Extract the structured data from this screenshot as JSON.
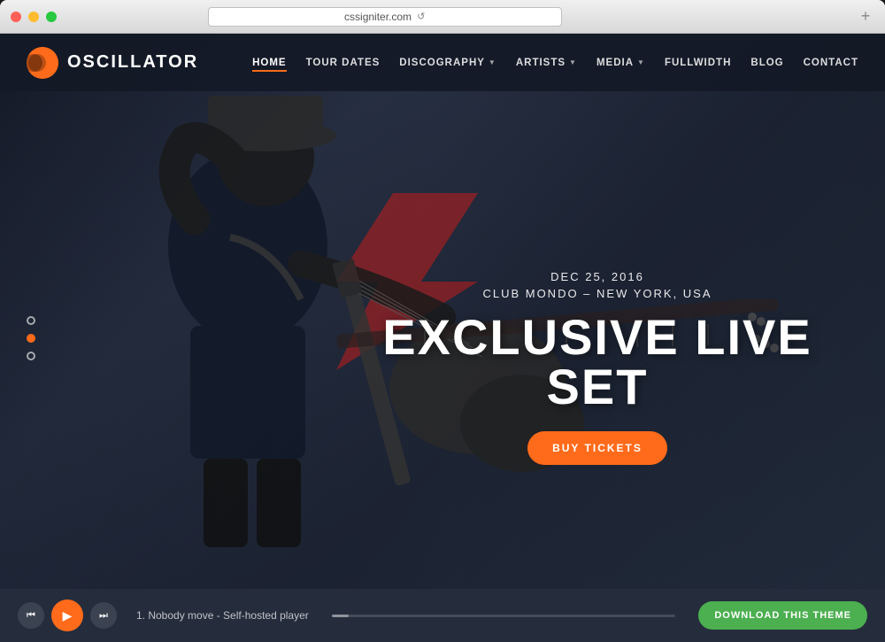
{
  "browser": {
    "url": "cssigniter.com",
    "new_tab_label": "+"
  },
  "logo": {
    "icon_symbol": "◑",
    "text": "OSCILLATOR"
  },
  "nav": {
    "links": [
      {
        "label": "HOME",
        "active": true,
        "has_dropdown": false
      },
      {
        "label": "TOUR DATES",
        "active": false,
        "has_dropdown": false
      },
      {
        "label": "DISCOGRAPHY",
        "active": false,
        "has_dropdown": true
      },
      {
        "label": "ARTISTS",
        "active": false,
        "has_dropdown": true
      },
      {
        "label": "MEDIA",
        "active": false,
        "has_dropdown": true
      },
      {
        "label": "FULLWIDTH",
        "active": false,
        "has_dropdown": false
      },
      {
        "label": "BLOG",
        "active": false,
        "has_dropdown": false
      },
      {
        "label": "CONTACT",
        "active": false,
        "has_dropdown": false
      }
    ]
  },
  "hero": {
    "event_date": "DEC 25, 2016",
    "event_location": "CLUB MONDO – NEW YORK, USA",
    "title": "EXCLUSIVE LIVE SET",
    "cta_button": "BUY TICKETS"
  },
  "player": {
    "prev_label": "⏮",
    "play_label": "▶",
    "next_label": "⏭",
    "track_info": "1. Nobody move - Self-hosted player",
    "download_btn": "DOWNLOAD THIS THEME"
  },
  "slides": {
    "total": 3,
    "active": 1
  },
  "colors": {
    "accent": "#ff6b1a",
    "nav_bg": "rgba(20,25,38,0.92)",
    "player_bg": "#252d3d",
    "download_green": "#4caf50",
    "lightning_red": "rgba(180,30,30,0.6)"
  }
}
